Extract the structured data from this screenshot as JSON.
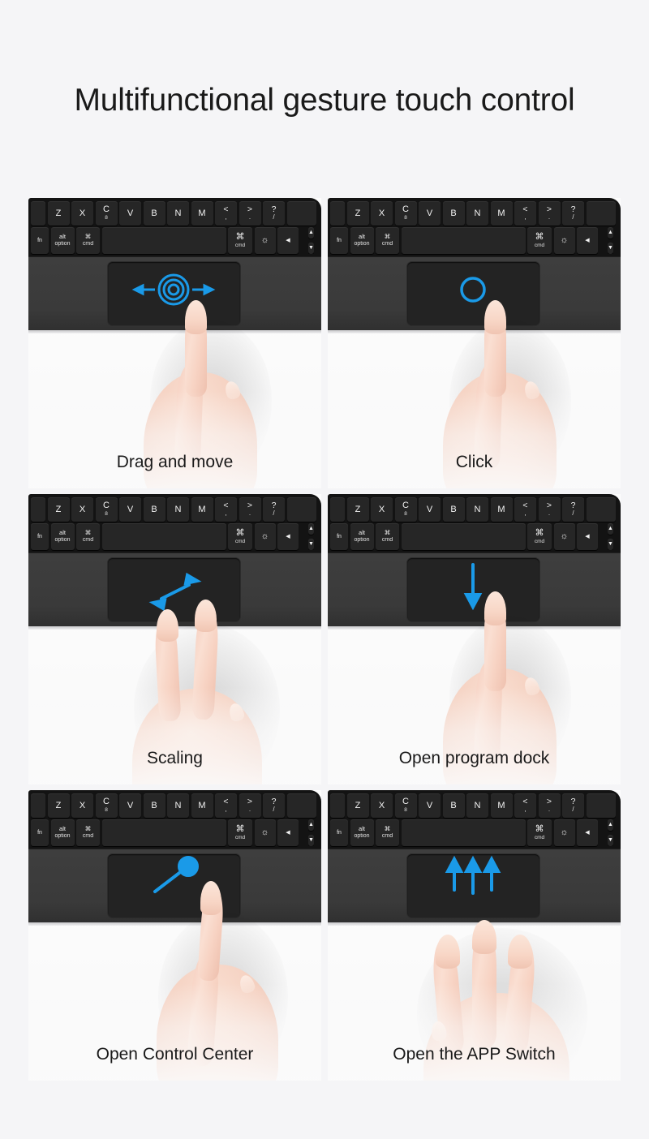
{
  "page": {
    "title": "Multifunctional gesture touch control",
    "background_color": "#f5f5f7",
    "accent_color": "#1a9ae8",
    "title_color": "#1a1a1a"
  },
  "keyboard": {
    "row1": [
      {
        "name": "key-z",
        "top": "Z",
        "bot": ""
      },
      {
        "name": "key-x",
        "top": "X",
        "bot": ""
      },
      {
        "name": "key-c",
        "top": "C",
        "bot": "8"
      },
      {
        "name": "key-v",
        "top": "V",
        "bot": ""
      },
      {
        "name": "key-b",
        "top": "B",
        "bot": ""
      },
      {
        "name": "key-n",
        "top": "N",
        "bot": ""
      },
      {
        "name": "key-m",
        "top": "M",
        "bot": ""
      },
      {
        "name": "key-comma",
        "top": "<",
        "bot": ","
      },
      {
        "name": "key-period",
        "top": ">",
        "bot": "."
      },
      {
        "name": "key-slash",
        "top": "?",
        "bot": "/"
      }
    ],
    "row2": [
      {
        "name": "key-fn",
        "top": "fn",
        "bot": ""
      },
      {
        "name": "key-option",
        "top": "alt",
        "bot": "option"
      },
      {
        "name": "key-command-left",
        "top": "⌘",
        "bot": "cmd"
      },
      {
        "name": "key-spacebar",
        "top": "",
        "bot": ""
      },
      {
        "name": "key-command-right",
        "top": "⌘",
        "bot": "cmd"
      },
      {
        "name": "key-brightness",
        "top": "☼",
        "bot": ""
      },
      {
        "name": "key-arrow-left",
        "top": "◀",
        "bot": ""
      },
      {
        "name": "key-arrow-updown",
        "top": "▲",
        "bot": "▼"
      }
    ]
  },
  "panels": [
    {
      "id": "drag-and-move",
      "caption": "Drag and move",
      "gesture": "one-finger-drag",
      "fingers": 1,
      "indicator": "concentric-circles-with-left-right-arrows"
    },
    {
      "id": "click",
      "caption": "Click",
      "gesture": "one-finger-tap",
      "fingers": 1,
      "indicator": "single-circle-tap"
    },
    {
      "id": "scaling",
      "caption": "Scaling",
      "gesture": "two-finger-pinch",
      "fingers": 2,
      "indicator": "double-headed-diagonal-arrow"
    },
    {
      "id": "open-program-dock",
      "caption": "Open program dock",
      "gesture": "one-finger-swipe-down",
      "fingers": 1,
      "indicator": "down-arrow"
    },
    {
      "id": "open-control-center",
      "caption": "Open Control Center",
      "gesture": "one-finger-diagonal-swipe",
      "fingers": 1,
      "indicator": "diagonal-swipe-with-dot"
    },
    {
      "id": "open-the-app-switch",
      "caption": "Open the APP Switch",
      "gesture": "three-finger-swipe-up",
      "fingers": 3,
      "indicator": "three-up-arrows"
    }
  ]
}
